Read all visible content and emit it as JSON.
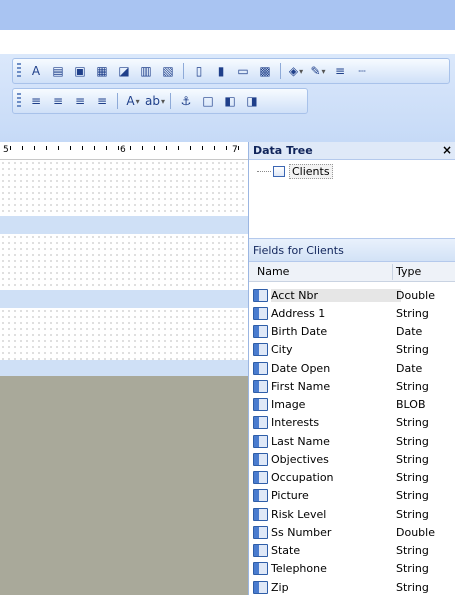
{
  "toolbar": {
    "row1": [
      {
        "name": "text-tool-icon",
        "glyph": "A"
      },
      {
        "name": "label-tool-icon",
        "glyph": "▤"
      },
      {
        "name": "picture-tool-icon",
        "glyph": "▣"
      },
      {
        "name": "chart-tool-icon",
        "glyph": "▦"
      },
      {
        "name": "subreport-tool-icon",
        "glyph": "◪"
      },
      {
        "name": "table-tool-icon",
        "glyph": "▥"
      },
      {
        "name": "crosstab-tool-icon",
        "glyph": "▧"
      },
      {
        "name": "columns-icon",
        "glyph": "▯"
      },
      {
        "name": "page-layout-icon",
        "glyph": "▮"
      },
      {
        "name": "image-box-icon",
        "glyph": "▭"
      },
      {
        "name": "properties-icon",
        "glyph": "▩"
      },
      {
        "name": "fill-color-icon",
        "glyph": "◈"
      },
      {
        "name": "line-color-icon",
        "glyph": "✎"
      },
      {
        "name": "line-style-icon",
        "glyph": "≡"
      },
      {
        "name": "dash-style-icon",
        "glyph": "┈"
      }
    ],
    "row2": [
      {
        "name": "align-left-icon",
        "glyph": "≡"
      },
      {
        "name": "align-center-icon",
        "glyph": "≡"
      },
      {
        "name": "align-right-icon",
        "glyph": "≡"
      },
      {
        "name": "justify-icon",
        "glyph": "≡"
      },
      {
        "name": "font-color-icon",
        "glyph": "A"
      },
      {
        "name": "highlight-icon",
        "glyph": "ab"
      },
      {
        "name": "anchor-icon",
        "glyph": "⚓"
      },
      {
        "name": "border-icon",
        "glyph": "□"
      },
      {
        "name": "bring-front-icon",
        "glyph": "◧"
      },
      {
        "name": "send-back-icon",
        "glyph": "◨"
      }
    ]
  },
  "ruler": {
    "labels": [
      "5",
      "6",
      "7"
    ]
  },
  "data_tree": {
    "title": "Data Tree",
    "close_glyph": "×",
    "root_label": "Clients"
  },
  "fields": {
    "header": "Fields for Clients",
    "col_name": "Name",
    "col_type": "Type",
    "rows": [
      {
        "name": "Acct Nbr",
        "type": "Double"
      },
      {
        "name": "Address 1",
        "type": "String"
      },
      {
        "name": "Birth Date",
        "type": "Date"
      },
      {
        "name": "City",
        "type": "String"
      },
      {
        "name": "Date Open",
        "type": "Date"
      },
      {
        "name": "First Name",
        "type": "String"
      },
      {
        "name": "Image",
        "type": "BLOB"
      },
      {
        "name": "Interests",
        "type": "String"
      },
      {
        "name": "Last Name",
        "type": "String"
      },
      {
        "name": "Objectives",
        "type": "String"
      },
      {
        "name": "Occupation",
        "type": "String"
      },
      {
        "name": "Picture",
        "type": "String"
      },
      {
        "name": "Risk Level",
        "type": "String"
      },
      {
        "name": "Ss Number",
        "type": "Double"
      },
      {
        "name": "State",
        "type": "String"
      },
      {
        "name": "Telephone",
        "type": "String"
      },
      {
        "name": "Zip",
        "type": "String"
      }
    ]
  },
  "colors": {
    "title_bar": "#a9c4f2",
    "toolbar_bg": "#c6daf7",
    "band_separator": "#cfe0f6",
    "design_background": "#a9a99a"
  }
}
